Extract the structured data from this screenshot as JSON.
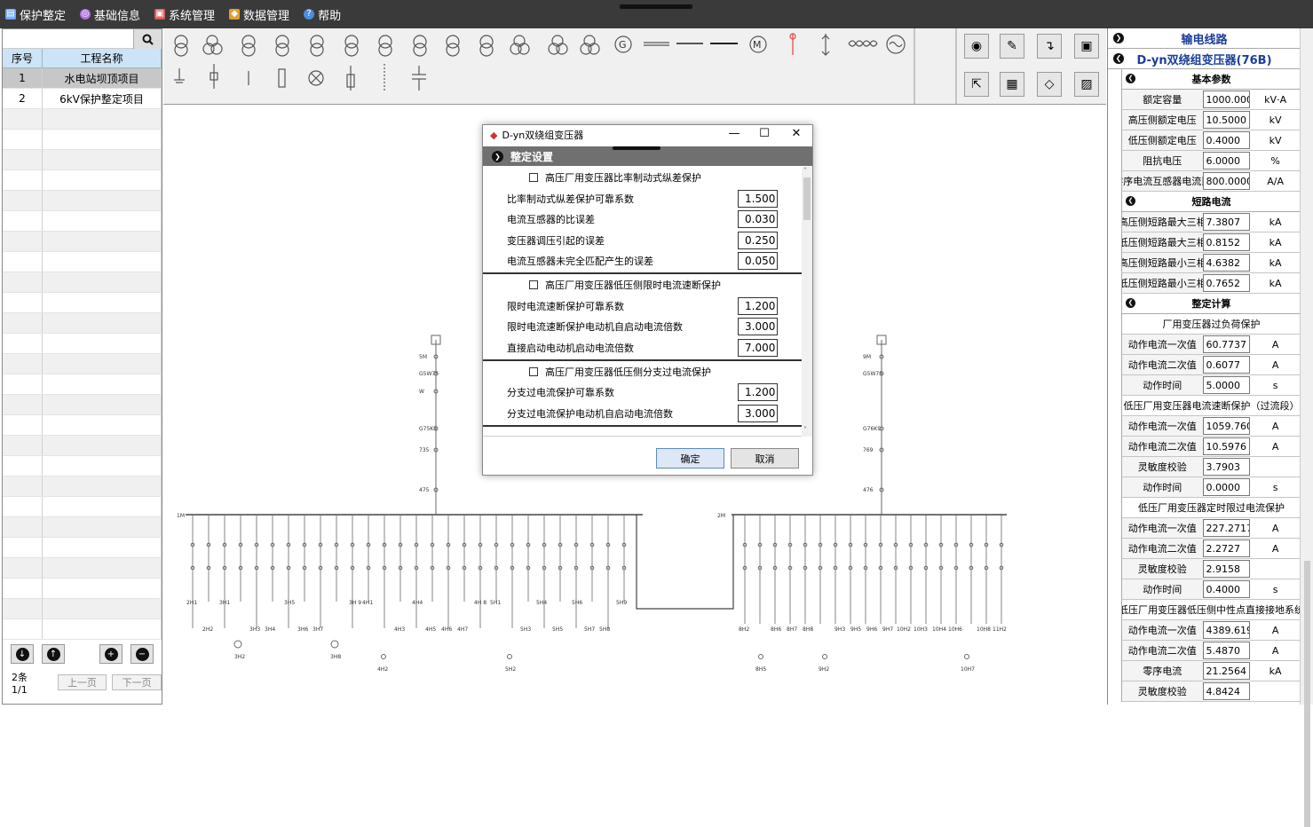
{
  "menu": {
    "items": [
      {
        "label": "保护整定",
        "icon": "document-icon",
        "color": "#6fa8ff"
      },
      {
        "label": "基础信息",
        "icon": "info-circle-icon",
        "color": "#b06fe0"
      },
      {
        "label": "系统管理",
        "icon": "monitor-icon",
        "color": "#e05a5a"
      },
      {
        "label": "数据管理",
        "icon": "chart-icon",
        "color": "#e0a030"
      },
      {
        "label": "帮助",
        "icon": "help-icon",
        "color": "#4a8ee0"
      }
    ]
  },
  "project_list": {
    "columns": [
      "序号",
      "工程名称"
    ],
    "rows": [
      {
        "no": "1",
        "name": "水电站坝顶项目"
      },
      {
        "no": "2",
        "name": "6kV保护整定项目"
      }
    ],
    "pager": {
      "count": "2条 1/1",
      "prev": "上一页",
      "next": "下一页"
    }
  },
  "right_panel": {
    "line_header": "输电线路",
    "transformer_header": "D-yn双绕组变压器(76B)",
    "basic": {
      "title": "基本参数",
      "rows": [
        {
          "name": "额定容量",
          "value": "1000.0000",
          "unit": "kV·A"
        },
        {
          "name": "高压侧额定电压",
          "value": "10.5000",
          "unit": "kV"
        },
        {
          "name": "低压侧额定电压",
          "value": "0.4000",
          "unit": "kV"
        },
        {
          "name": "阻抗电压",
          "value": "6.0000",
          "unit": "%"
        },
        {
          "name": "零序电流互感器电流比",
          "value": "800.0000",
          "unit": "A/A"
        }
      ]
    },
    "short_circuit": {
      "title": "短路电流",
      "rows": [
        {
          "name": "高压侧短路最大三相",
          "value": "7.3807",
          "unit": "kA"
        },
        {
          "name": "低压侧短路最大三相",
          "value": "0.8152",
          "unit": "kA"
        },
        {
          "name": "高压侧短路最小三相",
          "value": "4.6382",
          "unit": "kA"
        },
        {
          "name": "低压侧短路最小三相",
          "value": "0.7652",
          "unit": "kA"
        }
      ]
    },
    "calc": {
      "title": "整定计算",
      "groups": [
        {
          "title": "厂用变压器过负荷保护",
          "rows": [
            {
              "name": "动作电流一次值",
              "value": "60.7737",
              "unit": "A"
            },
            {
              "name": "动作电流二次值",
              "value": "0.6077",
              "unit": "A"
            },
            {
              "name": "动作时间",
              "value": "5.0000",
              "unit": "s"
            }
          ]
        },
        {
          "title": "低压厂用变压器电流速断保护（过流段）",
          "rows": [
            {
              "name": "动作电流一次值",
              "value": "1059.7600",
              "unit": "A"
            },
            {
              "name": "动作电流二次值",
              "value": "10.5976",
              "unit": "A"
            },
            {
              "name": "灵敏度校验",
              "value": "3.7903",
              "unit": ""
            },
            {
              "name": "动作时间",
              "value": "0.0000",
              "unit": "s"
            }
          ]
        },
        {
          "title": "低压厂用变压器定时限过电流保护",
          "rows": [
            {
              "name": "动作电流一次值",
              "value": "227.2717",
              "unit": "A"
            },
            {
              "name": "动作电流二次值",
              "value": "2.2727",
              "unit": "A"
            },
            {
              "name": "灵敏度校验",
              "value": "2.9158",
              "unit": ""
            },
            {
              "name": "动作时间",
              "value": "0.4000",
              "unit": "s"
            }
          ]
        },
        {
          "title": "低压厂用变压器低压侧中性点直接接地系统",
          "rows": [
            {
              "name": "动作电流一次值",
              "value": "4389.6190",
              "unit": "A"
            },
            {
              "name": "动作电流二次值",
              "value": "5.4870",
              "unit": "A"
            },
            {
              "name": "零序电流",
              "value": "21.2564",
              "unit": "kA"
            },
            {
              "name": "灵敏度校验",
              "value": "4.8424",
              "unit": ""
            }
          ]
        }
      ]
    }
  },
  "dialog": {
    "title": "D-yn双绕组变压器",
    "section": "整定设置",
    "groups": [
      {
        "title": "高压厂用变压器比率制动式纵差保护",
        "fields": [
          {
            "label": "比率制动式纵差保护可靠系数",
            "value": "1.500"
          },
          {
            "label": "电流互感器的比误差",
            "value": "0.030"
          },
          {
            "label": "变压器调压引起的误差",
            "value": "0.250"
          },
          {
            "label": "电流互感器未完全匹配产生的误差",
            "value": "0.050"
          }
        ]
      },
      {
        "title": "高压厂用变压器低压侧限时电流速断保护",
        "fields": [
          {
            "label": "限时电流速断保护可靠系数",
            "value": "1.200"
          },
          {
            "label": "限时电流速断保护电动机自启动电流倍数",
            "value": "3.000"
          },
          {
            "label": "直接启动电动机启动电流倍数",
            "value": "7.000"
          }
        ]
      },
      {
        "title": "高压厂用变压器低压侧分支过电流保护",
        "fields": [
          {
            "label": "分支过电流保护可靠系数",
            "value": "1.200"
          },
          {
            "label": "分支过电流保护电动机自启动电流倍数",
            "value": "3.000"
          }
        ]
      }
    ],
    "ok": "确定",
    "cancel": "取消"
  },
  "diagram": {
    "left_labels": [
      "5M",
      "G5W75",
      "W",
      "G75K5",
      "735",
      "475",
      "1M"
    ],
    "right_labels": [
      "9M",
      "G5W75",
      "G76K9",
      "769",
      "476",
      "2M"
    ],
    "left_feeders_top": [
      "2H1",
      "3H1",
      "3H5",
      "3H 9",
      "4H1",
      "4H4",
      "4H 8",
      "5H1",
      "5H4",
      "5H6",
      "5H9"
    ],
    "left_feeders_bottom": [
      "2H2",
      "3H3",
      "3H4",
      "3H6",
      "3H7",
      "4H3",
      "4H5",
      "4H6",
      "4H7",
      "5H3",
      "5H5",
      "5H7",
      "5H8"
    ],
    "left_feeders_lower": [
      "3H2",
      "3H8",
      "4H2",
      "5H2"
    ],
    "right_feeders_bottom": [
      "8H2",
      "8H6",
      "8H7",
      "8H8",
      "9H3",
      "9H5",
      "9H6",
      "9H7",
      "10H2",
      "10H3",
      "10H4",
      "10H6",
      "10H8",
      "11H2"
    ],
    "right_feeders_lower": [
      "8H5",
      "9H2",
      "10H7"
    ]
  }
}
